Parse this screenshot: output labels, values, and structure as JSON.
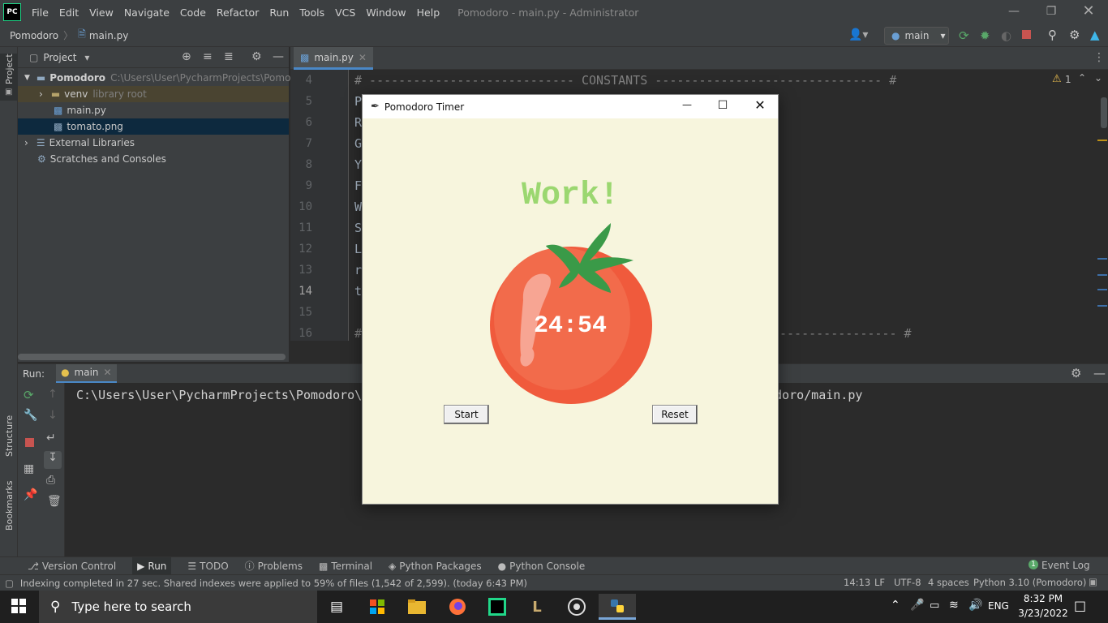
{
  "titlebar": {
    "logo": "PC",
    "menus": [
      "File",
      "Edit",
      "View",
      "Navigate",
      "Code",
      "Refactor",
      "Run",
      "Tools",
      "VCS",
      "Window",
      "Help"
    ],
    "title": "Pomodoro - main.py - Administrator"
  },
  "navbar": {
    "project": "Pomodoro",
    "file": "main.py",
    "run_config": "main"
  },
  "project_panel": {
    "header": "Project",
    "root": {
      "name": "Pomodoro",
      "path": "C:\\Users\\User\\PycharmProjects\\Pomodoro"
    },
    "venv": {
      "name": "venv",
      "hint": "library root"
    },
    "files": [
      "main.py",
      "tomato.png"
    ],
    "external": "External Libraries",
    "scratches": "Scratches and Consoles"
  },
  "side_labels": {
    "project": "Project",
    "structure": "Structure",
    "bookmarks": "Bookmarks"
  },
  "editor": {
    "tab": "main.py",
    "line_numbers": [
      "4",
      "5",
      "6",
      "7",
      "8",
      "9",
      "10",
      "11",
      "12",
      "13",
      "14",
      "15",
      "16"
    ],
    "lines": [
      "# ---------------------------- CONSTANTS ------------------------------- #",
      "P",
      "R",
      "G",
      "Y",
      "F",
      "W",
      "S",
      "L",
      "r",
      "t",
      "",
      ""
    ],
    "line16_left": "#",
    "line16_right": "---------------- #",
    "warnings": "1"
  },
  "run_panel": {
    "label": "Run:",
    "tab": "main",
    "console_left": "C:\\Users\\User\\PycharmProjects\\Pomodoro\\",
    "console_right": "odoro/main.py"
  },
  "bottom_tools": [
    "Version Control",
    "Run",
    "TODO",
    "Problems",
    "Terminal",
    "Python Packages",
    "Python Console"
  ],
  "event_log": "Event Log",
  "event_count": "1",
  "status": {
    "message": "Indexing completed in 27 sec. Shared indexes were applied to 59% of files (1,542 of 2,599). (today 6:43 PM)",
    "position": "14:13",
    "line_sep": "LF",
    "encoding": "UTF-8",
    "indent": "4 spaces",
    "interpreter": "Python 3.10 (Pomodoro)"
  },
  "taskbar": {
    "search_placeholder": "Type here to search",
    "lang": "ENG",
    "time": "8:32 PM",
    "date": "3/23/2022"
  },
  "tk_window": {
    "title": "Pomodoro Timer",
    "heading": "Work!",
    "timer": "24:54",
    "start_label": "Start",
    "reset_label": "Reset"
  },
  "colors": {
    "heading_green": "#9bd770",
    "tomato_red": "#f05a3c",
    "window_bg": "#f7f5dd",
    "ide_dark": "#2b2b2b",
    "ide_panel": "#3c3f41"
  }
}
